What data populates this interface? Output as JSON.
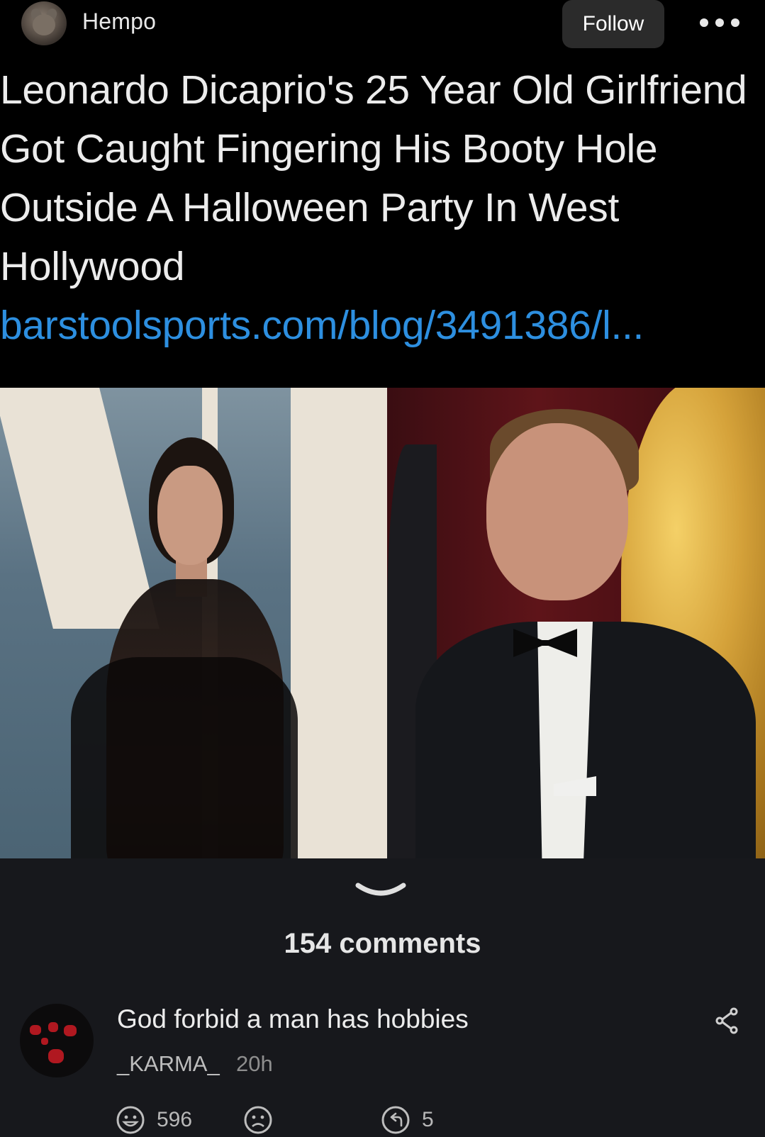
{
  "header": {
    "username": "Hempo",
    "follow_label": "Follow"
  },
  "post": {
    "title_text": "Leonardo Dicaprio's 25 Year Old Girlfriend Got Caught Fingering His Booty Hole Outside A Halloween Party In West Hollywood",
    "link_text": "barstoolsports.com/blog/3491386/l..."
  },
  "comments": {
    "count_label": "154 comments",
    "items": [
      {
        "text": "God forbid a man has hobbies",
        "user": "_KARMA_",
        "time": "20h",
        "likes": "596",
        "replies": "5"
      }
    ]
  },
  "colors": {
    "background": "#000000",
    "panel": "#17181c",
    "link": "#2d8fe0",
    "follow_button": "#2b2b2b"
  },
  "icons": [
    "more-icon",
    "chevron-down-icon",
    "share-icon",
    "smile-icon",
    "frown-icon",
    "reply-icon"
  ]
}
